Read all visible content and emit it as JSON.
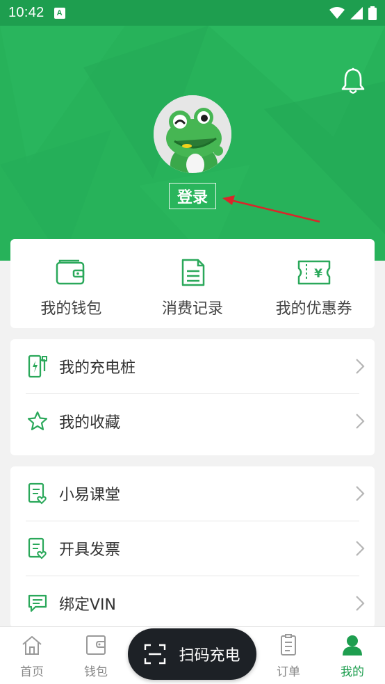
{
  "status_bar": {
    "time": "10:42",
    "notification_badge": "A"
  },
  "header": {
    "login_label": "登录",
    "bg_color": "#27b25a"
  },
  "quick_actions": [
    {
      "label": "我的钱包",
      "icon": "wallet-icon"
    },
    {
      "label": "消费记录",
      "icon": "document-icon"
    },
    {
      "label": "我的优惠券",
      "icon": "coupon-icon"
    }
  ],
  "menu_group_1": [
    {
      "label": "我的充电桩",
      "icon": "charger-icon"
    },
    {
      "label": "我的收藏",
      "icon": "star-icon"
    }
  ],
  "menu_group_2": [
    {
      "label": "小易课堂",
      "icon": "classroom-icon"
    },
    {
      "label": "开具发票",
      "icon": "invoice-icon"
    },
    {
      "label": "绑定VIN",
      "icon": "message-icon"
    }
  ],
  "bottom_nav": {
    "items": [
      {
        "label": "首页",
        "icon": "home-icon"
      },
      {
        "label": "钱包",
        "icon": "wallet-icon"
      },
      {
        "label": "订单",
        "icon": "order-icon"
      },
      {
        "label": "我的",
        "icon": "profile-icon",
        "active": true
      }
    ],
    "scan_label": "扫码充电"
  },
  "colors": {
    "accent": "#1e9e4f",
    "scan_button": "#1d2126",
    "arrow": "#d9262a"
  }
}
